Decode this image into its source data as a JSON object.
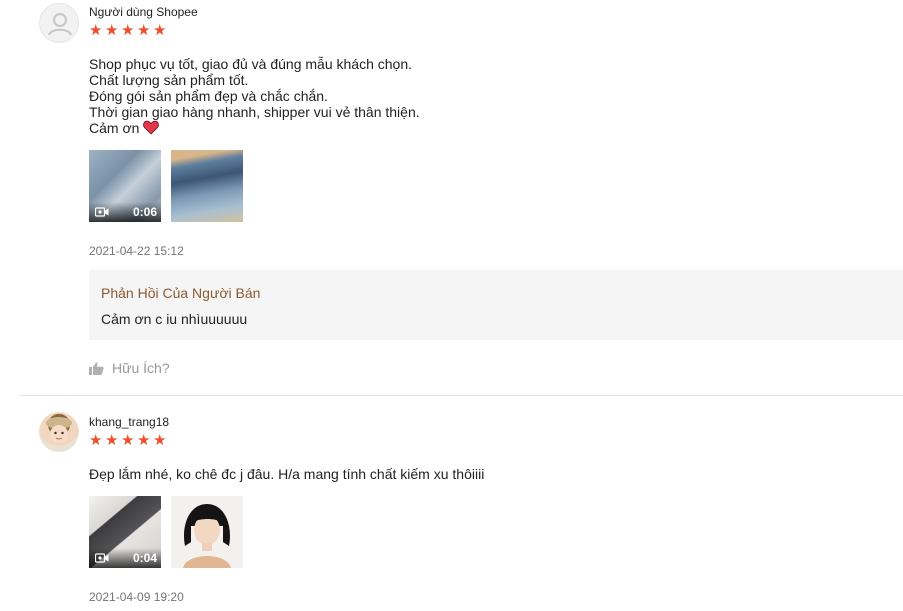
{
  "colors": {
    "star": "#ee4d2d",
    "seller_title": "#8c5a2f",
    "muted": "#757575"
  },
  "reviews": [
    {
      "username": "Người dùng Shopee",
      "avatar_icon": "default-user-icon",
      "rating": 5,
      "comment_lines": [
        "Shop phục vụ tốt, giao đủ và đúng mẫu khách chọn.",
        "Chất lượng sản phẩm tốt.",
        "Đóng gói sản phẩm đẹp và chắc chắn.",
        "Thời gian giao hàng nhanh, shipper vui vẻ thân thiện.",
        "Cảm ơn"
      ],
      "media": [
        {
          "kind": "video",
          "duration": "0:06"
        },
        {
          "kind": "image"
        }
      ],
      "time": "2021-04-22 15:12",
      "seller_reply": {
        "title": "Phản Hồi Của Người Bán",
        "text": "Cảm ơn c iu nhìuuuuuu"
      },
      "helpful_label": "Hữu Ích?"
    },
    {
      "username": "khang_trang18",
      "avatar_icon": "user-photo-avatar",
      "rating": 5,
      "comment_lines": [
        "Đẹp lắm nhé, ko chê đc j đâu. H/a mang tính chất kiếm xu thôiiii"
      ],
      "media": [
        {
          "kind": "video",
          "duration": "0:04"
        },
        {
          "kind": "image"
        }
      ],
      "time": "2021-04-09 19:20"
    }
  ]
}
